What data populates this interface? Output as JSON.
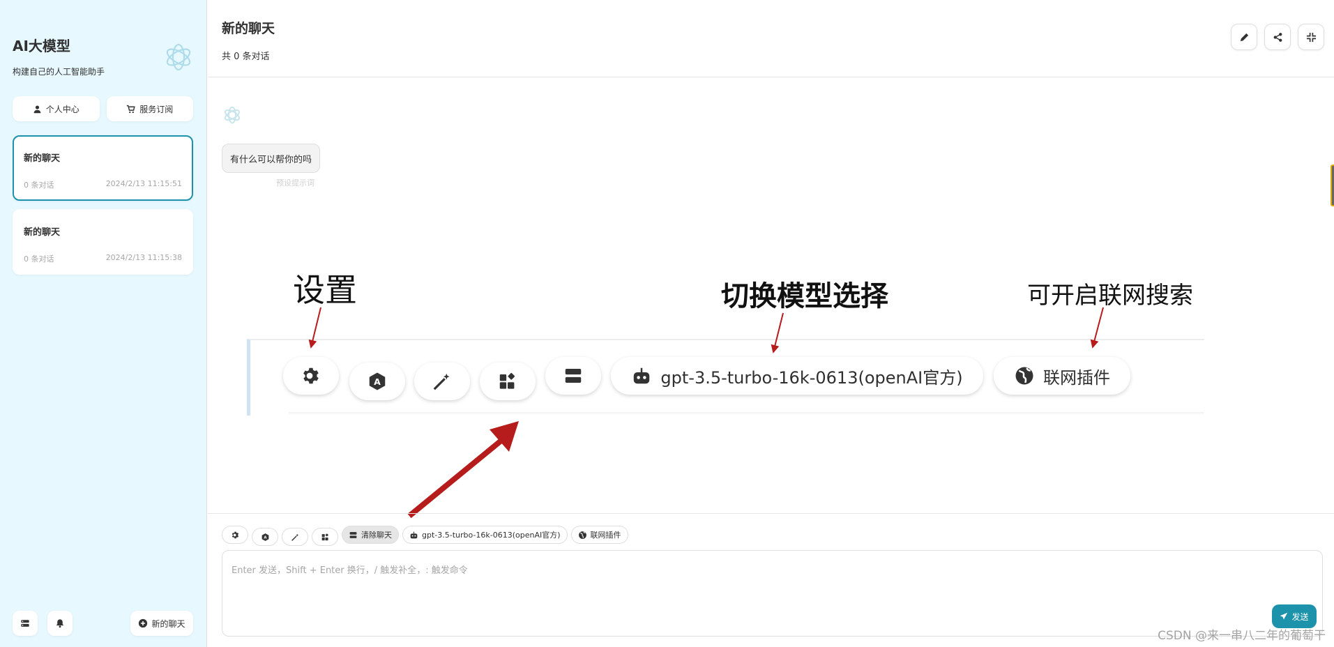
{
  "sidebar": {
    "title": "AI大模型",
    "subtitle": "构建自己的人工智能助手",
    "buttons": {
      "profile": "个人中心",
      "subscribe": "服务订阅"
    },
    "chats": [
      {
        "title": "新的聊天",
        "count": "0 条对话",
        "date": "2024/2/13 11:15:51",
        "selected": true
      },
      {
        "title": "新的聊天",
        "count": "0 条对话",
        "date": "2024/2/13 11:15:38",
        "selected": false
      }
    ],
    "new_chat": "新的聊天"
  },
  "header": {
    "title": "新的聊天",
    "subtitle": "共 0 条对话",
    "actions": [
      "edit-icon",
      "share-icon",
      "collapse-icon"
    ]
  },
  "messages": [
    {
      "role": "bot",
      "text": "有什么可以帮你的吗",
      "note": "预设提示词"
    }
  ],
  "annotation": {
    "settings": "设置",
    "model_switch": "切换模型选择",
    "web_search": "可开启联网搜索",
    "model_chip": "gpt-3.5-turbo-16k-0613(openAI官方)",
    "web_chip": "联网插件"
  },
  "input": {
    "chips": {
      "clear": "清除聊天",
      "model": "gpt-3.5-turbo-16k-0613(openAI官方)",
      "web": "联网插件"
    },
    "placeholder": "Enter 发送，Shift + Enter 换行，/ 触发补全，: 触发命令",
    "send": "发送"
  },
  "watermark": "CSDN @来一串八二年的葡萄干",
  "colors": {
    "accent": "#1d93ab",
    "sidebar_bg": "#e7f8ff",
    "arrow": "#b71c1c"
  }
}
